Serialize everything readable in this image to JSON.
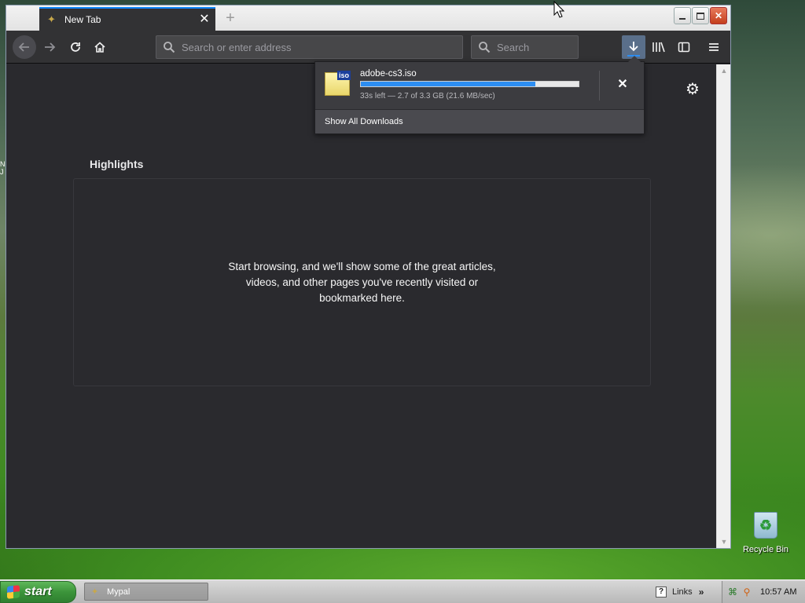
{
  "desktop": {
    "recycle_bin_label": "Recycle Bin",
    "edge_fragment_1": "N",
    "edge_fragment_2": "J"
  },
  "browser": {
    "tab": {
      "title": "New Tab",
      "favicon": "mypal-icon"
    },
    "toolbar": {
      "url_placeholder": "Search or enter address",
      "search_placeholder": "Search"
    },
    "content": {
      "section_title": "Highlights",
      "empty_message": "Start browsing, and we'll show some of the great articles, videos, and other pages you've recently visited or bookmarked here."
    },
    "downloads_panel": {
      "filename": "adobe-cs3.iso",
      "file_type_tag": "iso",
      "progress_fraction": 0.8,
      "status": "33s left — 2.7 of 3.3 GB (21.6 MB/sec)",
      "show_all_label": "Show All Downloads"
    }
  },
  "taskbar": {
    "start_label": "start",
    "task_button_label": "Mypal",
    "links_label": "Links",
    "clock": "10:57 AM"
  },
  "colors": {
    "accent": "#0a84ff",
    "progress": "#2d8ef2",
    "content_bg": "#2a2a2e",
    "toolbar_bg": "#323234"
  }
}
